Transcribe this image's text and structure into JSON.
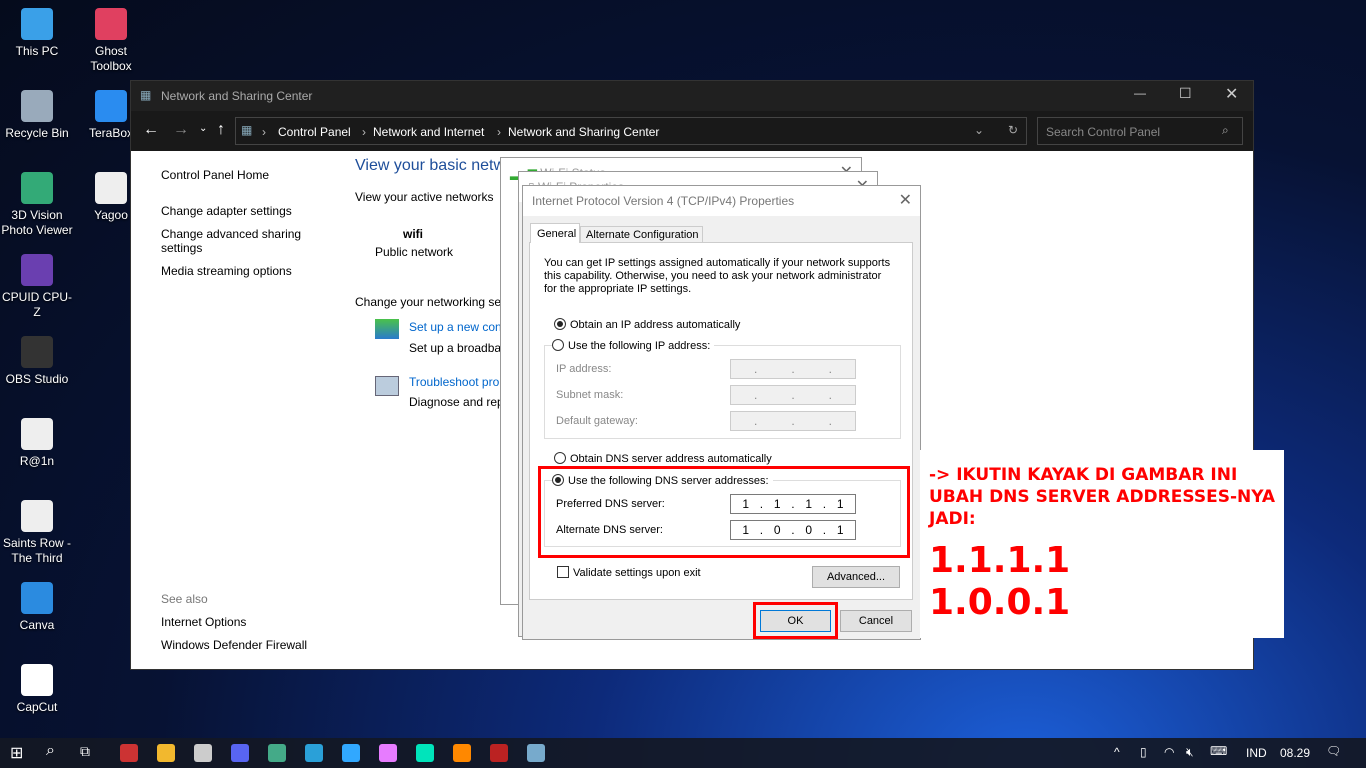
{
  "desktop": {
    "icons": [
      {
        "label": "This PC",
        "color": "#3aa0e8"
      },
      {
        "label": "Recycle Bin",
        "color": "#9ab"
      },
      {
        "label": "3D Vision Photo Viewer",
        "color": "#3a7"
      },
      {
        "label": "CPUID CPU-Z",
        "color": "#6a3fb0"
      },
      {
        "label": "OBS Studio",
        "color": "#333"
      },
      {
        "label": "R@1n",
        "color": "#eee"
      },
      {
        "label": "Saints Row - The Third",
        "color": "#eee"
      },
      {
        "label": "Canva",
        "color": "#2b8be0"
      },
      {
        "label": "CapCut",
        "color": "#fff"
      }
    ],
    "icons2": [
      {
        "label": "Ghost Toolbox",
        "color": "#e04060"
      },
      {
        "label": "TeraBox",
        "color": "#2a8cf0"
      },
      {
        "label": "Yagoo",
        "color": "#eee"
      }
    ]
  },
  "window": {
    "title": "Network and Sharing Center",
    "breadcrumb": [
      "Control Panel",
      "Network and Internet",
      "Network and Sharing Center"
    ],
    "search_placeholder": "Search Control Panel",
    "sidebar": {
      "items": [
        "Control Panel Home",
        "Change adapter settings",
        "Change advanced sharing settings",
        "Media streaming options"
      ],
      "see_also": "See also",
      "see_also_items": [
        "Internet Options",
        "Windows Defender Firewall"
      ]
    },
    "main": {
      "heading": "View your basic netw",
      "active": "View your active networks",
      "network_name": "wifi",
      "network_type": "Public network",
      "change": "Change your networking set",
      "task1_link": "Set up a new conn",
      "task1_desc": "Set up a broadbar",
      "task2_link": "Troubleshoot prob",
      "task2_desc": "Diagnose and repa"
    }
  },
  "wifi_status": {
    "title": "Wi-Fi Status"
  },
  "wifi_props": {
    "title": "Wi-Fi Properties"
  },
  "ipv4": {
    "title": "Internet Protocol Version 4 (TCP/IPv4) Properties",
    "tabs": [
      "General",
      "Alternate Configuration"
    ],
    "desc": "You can get IP settings assigned automatically if your network supports this capability. Otherwise, you need to ask your network administrator for the appropriate IP settings.",
    "obtain_ip": "Obtain an IP address automatically",
    "use_ip": "Use the following IP address:",
    "ip_label": "IP address:",
    "subnet_label": "Subnet mask:",
    "gateway_label": "Default gateway:",
    "obtain_dns": "Obtain DNS server address automatically",
    "use_dns": "Use the following DNS server addresses:",
    "preferred_label": "Preferred DNS server:",
    "alternate_label": "Alternate DNS server:",
    "preferred": [
      "1",
      "1",
      "1",
      "1"
    ],
    "alternate": [
      "1",
      "0",
      "0",
      "1"
    ],
    "validate": "Validate settings upon exit",
    "advanced": "Advanced...",
    "ok": "OK",
    "cancel": "Cancel"
  },
  "annotation": {
    "line1": "-> IKUTIN KAYAK DI GAMBAR INI",
    "line2": "UBAH DNS SERVER ADDRESSES-NYA",
    "line3": "JADI:",
    "dns1": "1.1.1.1",
    "dns2": "1.0.0.1",
    "color": "#ff0000"
  },
  "taskbar": {
    "lang": "IND",
    "time": "08.29"
  }
}
